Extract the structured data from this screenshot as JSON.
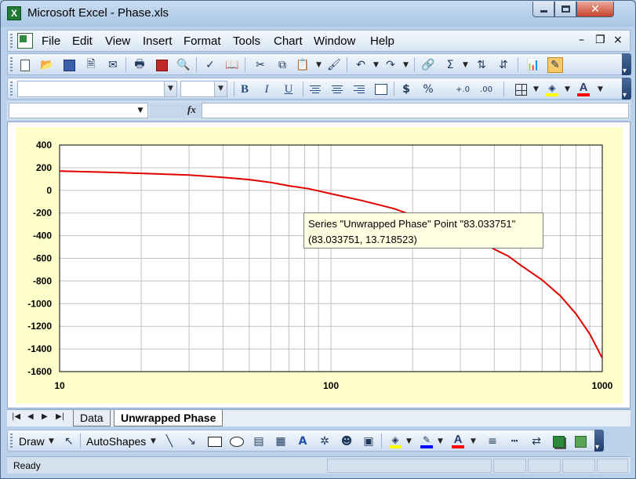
{
  "window": {
    "title": "Microsoft Excel - Phase.xls",
    "app_icon_letter": "X",
    "close_glyph": "✕"
  },
  "menu": {
    "items": [
      "File",
      "Edit",
      "View",
      "Insert",
      "Format",
      "Tools",
      "Chart",
      "Window",
      "Help"
    ],
    "close_glyph": "×",
    "restore_glyph": "🗗"
  },
  "formula_bar": {
    "name_box": "",
    "fx_label": "fx",
    "formula": ""
  },
  "formatting": {
    "font_name": "",
    "font_size": "",
    "bold": "B",
    "italic": "I",
    "underline": "U",
    "currency": "$",
    "percent": "%",
    "inc_decimal": "+.0",
    "dec_decimal": ".00"
  },
  "chart_data": {
    "type": "line",
    "x_scale": "log",
    "xlim": [
      10,
      1000
    ],
    "ylim": [
      -1600,
      400
    ],
    "x_ticks": [
      "10",
      "100",
      "1000"
    ],
    "y_ticks": [
      "400",
      "200",
      "0",
      "-200",
      "-400",
      "-600",
      "-800",
      "-1000",
      "-1200",
      "-1400",
      "-1600"
    ],
    "grid": true,
    "series": [
      {
        "name": "Unwrapped Phase",
        "color": "#e00000",
        "points": [
          [
            10,
            170
          ],
          [
            15,
            160
          ],
          [
            20,
            150
          ],
          [
            30,
            135
          ],
          [
            40,
            115
          ],
          [
            50,
            95
          ],
          [
            60,
            70
          ],
          [
            70,
            40
          ],
          [
            83.033751,
            13.718523
          ],
          [
            100,
            -30
          ],
          [
            130,
            -90
          ],
          [
            170,
            -160
          ],
          [
            200,
            -220
          ],
          [
            250,
            -300
          ],
          [
            300,
            -380
          ],
          [
            350,
            -440
          ],
          [
            400,
            -520
          ],
          [
            450,
            -580
          ],
          [
            500,
            -660
          ],
          [
            600,
            -790
          ],
          [
            700,
            -930
          ],
          [
            800,
            -1090
          ],
          [
            900,
            -1270
          ],
          [
            1000,
            -1480
          ]
        ]
      }
    ],
    "tooltip": {
      "line1": "Series \"Unwrapped Phase\" Point \"83.033751\"",
      "line2": "(83.033751, 13.718523)"
    }
  },
  "sheet_tabs": {
    "tabs": [
      "Data",
      "Unwrapped Phase"
    ],
    "active": "Unwrapped Phase"
  },
  "draw_toolbar": {
    "draw_label": "Draw",
    "autoshapes_label": "AutoShapes"
  },
  "status": {
    "text": "Ready"
  },
  "colors": {
    "chart_background": "#ffffcc",
    "series_line": "#e00000",
    "fill_highlight": "#ffff00",
    "line_color": "#0000ff",
    "font_color": "#ff0000"
  }
}
